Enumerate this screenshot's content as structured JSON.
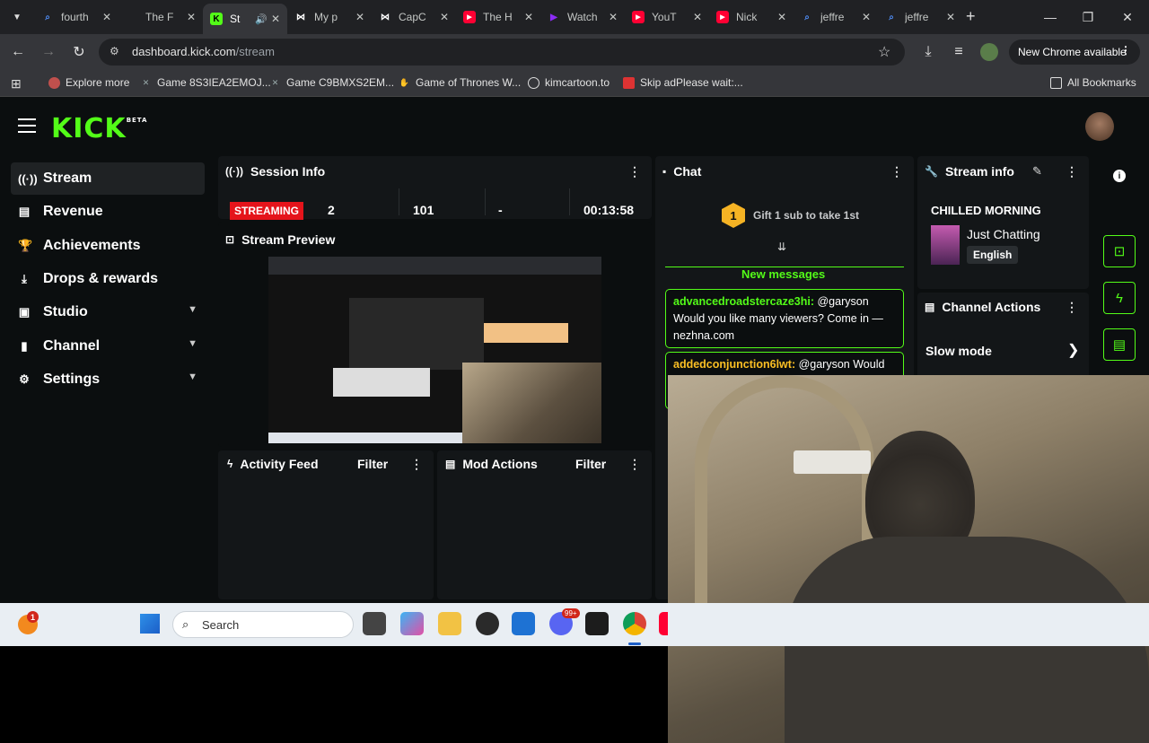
{
  "tabs": [
    {
      "title": "fourth",
      "favicon": "search-icon",
      "color": "#4f8ef7"
    },
    {
      "title": "The F",
      "favicon": "blank",
      "color": "#202124"
    },
    {
      "title": "St",
      "favicon": "kick-icon",
      "color": "#53fc18",
      "active": true
    },
    {
      "title": "My p",
      "favicon": "capcut-icon",
      "color": "#ffffff"
    },
    {
      "title": "CapC",
      "favicon": "capcut-icon",
      "color": "#ffffff"
    },
    {
      "title": "The H",
      "favicon": "youtube-icon",
      "color": "#ff0033"
    },
    {
      "title": "Watch",
      "favicon": "play-icon",
      "color": "#8b2cf5"
    },
    {
      "title": "YouT",
      "favicon": "youtube-icon",
      "color": "#ff0033"
    },
    {
      "title": "Nick",
      "favicon": "youtube-icon",
      "color": "#ff0033"
    },
    {
      "title": "jeffre",
      "favicon": "search-icon",
      "color": "#4f8ef7"
    },
    {
      "title": "jeffre",
      "favicon": "search-icon",
      "color": "#4f8ef7"
    }
  ],
  "browser": {
    "url_host": "dashboard.kick.com",
    "url_path": "/stream",
    "new_chrome": "New Chrome available"
  },
  "bookmarks": [
    {
      "label": "Explore more"
    },
    {
      "label": "Game 8S3IEA2EMOJ..."
    },
    {
      "label": "Game C9BMXS2EM..."
    },
    {
      "label": "Game of Thrones W..."
    },
    {
      "label": "kimcartoon.to"
    },
    {
      "label": "Skip adPlease wait:..."
    }
  ],
  "all_bookmarks": "All Bookmarks",
  "brand": {
    "logo": "KICK",
    "beta": "BETA",
    "accent": "#53fc18"
  },
  "sidebar": [
    {
      "label": "Stream",
      "icon": "broadcast-icon",
      "active": true
    },
    {
      "label": "Revenue",
      "icon": "chart-icon"
    },
    {
      "label": "Achievements",
      "icon": "trophy-icon"
    },
    {
      "label": "Drops & rewards",
      "icon": "drops-icon"
    },
    {
      "label": "Studio",
      "icon": "studio-icon",
      "expandable": true
    },
    {
      "label": "Channel",
      "icon": "channel-icon",
      "expandable": true
    },
    {
      "label": "Settings",
      "icon": "gear-icon",
      "expandable": true
    }
  ],
  "session": {
    "title": "Session Info",
    "status": "STREAMING",
    "stats": [
      "2",
      "101",
      "-",
      "00:13:58"
    ]
  },
  "preview": {
    "title": "Stream Preview"
  },
  "activity": {
    "title": "Activity Feed",
    "filter": "Filter"
  },
  "mod": {
    "title": "Mod Actions",
    "filter": "Filter"
  },
  "chat": {
    "title": "Chat",
    "gift_number": "1",
    "gift_text": "Gift 1 sub to take 1st",
    "new_messages": "New messages",
    "messages": [
      {
        "user": "advancedroadstercaze3hi:",
        "text": " @garyson Would you like many viewers? Come in — nezhna.com"
      },
      {
        "user": "addedconjunction6lwt:",
        "text": " @garyson Would"
      }
    ]
  },
  "stream_info": {
    "title": "Stream info",
    "stream_title": "CHILLED MORNING",
    "category": "Just Chatting",
    "language": "English"
  },
  "channel_actions": {
    "title": "Channel Actions",
    "slow_mode": "Slow mode"
  },
  "taskbar": {
    "search": "Search",
    "notification_count": "1",
    "discord_badge": "99+"
  }
}
